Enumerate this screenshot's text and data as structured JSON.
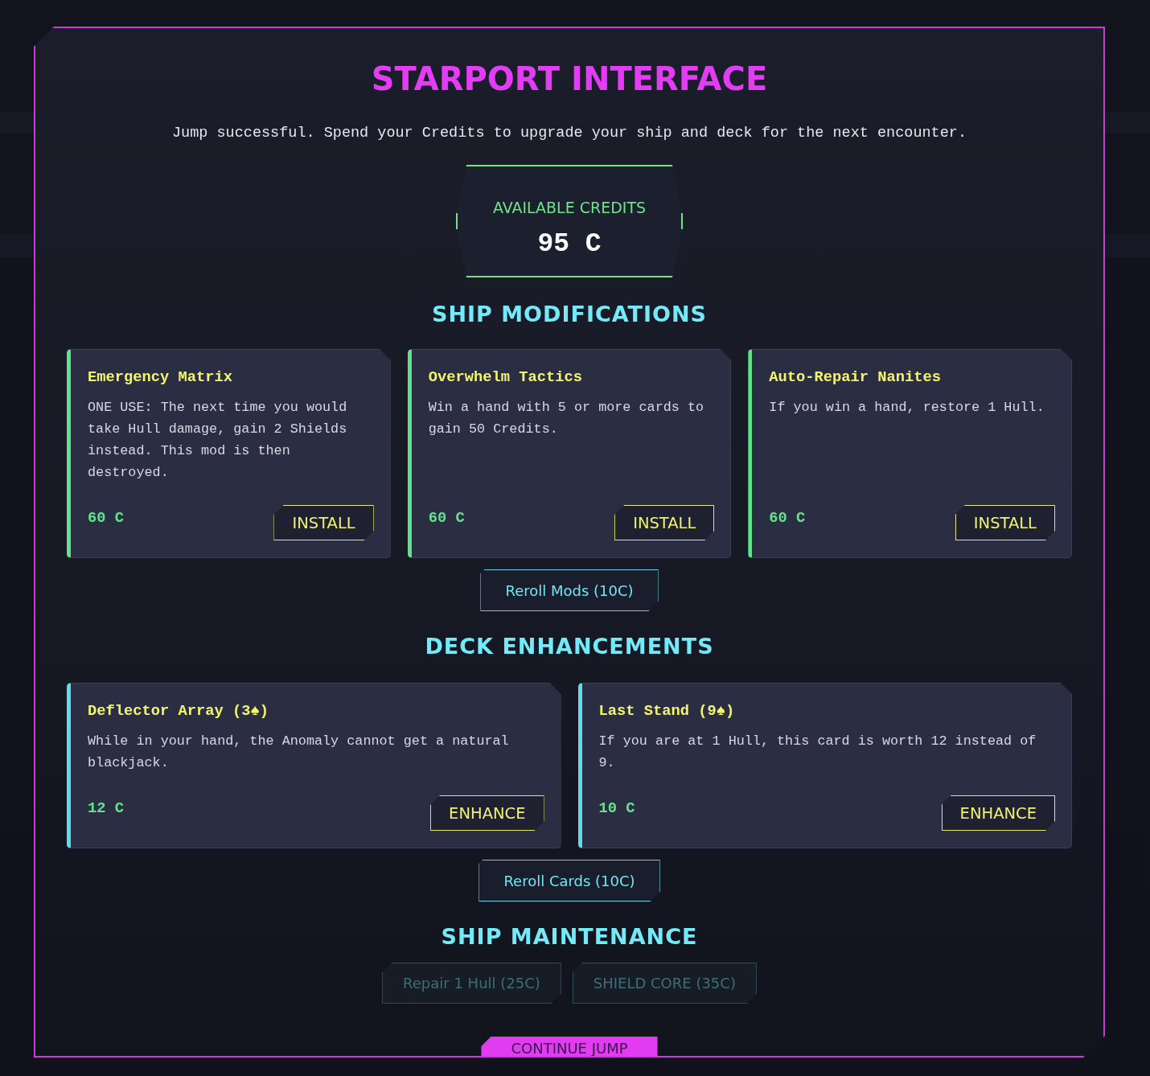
{
  "title": "STARPORT INTERFACE",
  "subtitle": "Jump successful. Spend your Credits to upgrade your ship and deck for the next encounter.",
  "credits": {
    "label": "AVAILABLE CREDITS",
    "value": "95 C"
  },
  "sections": [
    {
      "kind": "mods",
      "heading": "SHIP MODIFICATIONS",
      "items": [
        {
          "name": "Emergency Matrix",
          "description": "ONE USE: The next time you would take Hull damage, gain 2 Shields instead. This mod is then destroyed.",
          "price": "60 C",
          "action": "INSTALL"
        },
        {
          "name": "Overwhelm Tactics",
          "description": "Win a hand with 5 or more cards to gain 50 Credits.",
          "price": "60 C",
          "action": "INSTALL"
        },
        {
          "name": "Auto-Repair Nanites",
          "description": "If you win a hand, restore 1 Hull.",
          "price": "60 C",
          "action": "INSTALL"
        }
      ],
      "reroll": {
        "label": "Reroll Mods (10C)",
        "disabled": false
      }
    },
    {
      "kind": "cards",
      "heading": "DECK ENHANCEMENTS",
      "items": [
        {
          "name": "Deflector Array (3♠)",
          "description": "While in your hand, the Anomaly cannot get a natural blackjack.",
          "price": "12 C",
          "action": "ENHANCE"
        },
        {
          "name": "Last Stand (9♠)",
          "description": "If you are at 1 Hull, this card is worth 12 instead of 9.",
          "price": "10 C",
          "action": "ENHANCE"
        }
      ],
      "reroll": {
        "label": "Reroll Cards (10C)",
        "disabled": false
      }
    },
    {
      "kind": "maintenance",
      "heading": "SHIP MAINTENANCE",
      "buttons": [
        {
          "label": "Repair 1 Hull (25C)",
          "disabled": true
        },
        {
          "label": "SHIELD CORE (35C)",
          "disabled": true
        }
      ]
    }
  ],
  "continue_button": {
    "label": "CONTINUE JUMP"
  }
}
